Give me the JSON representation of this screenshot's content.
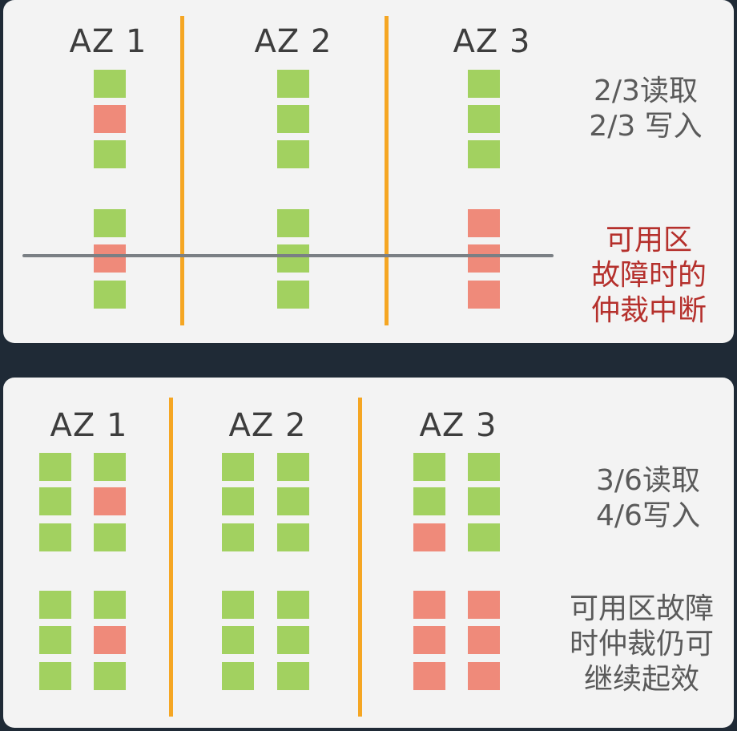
{
  "top_panel": {
    "az_labels": [
      "AZ 1",
      "AZ 2",
      "AZ 3"
    ],
    "rules": [
      "2/3读取",
      "2/3 写入"
    ],
    "failure_note": [
      "可用区",
      "故障时的",
      "仲裁中断"
    ],
    "replicas": {
      "az1": [
        "ok",
        "failed",
        "ok",
        "ok",
        "failed",
        "ok"
      ],
      "az2": [
        "ok",
        "ok",
        "ok",
        "ok",
        "ok",
        "ok"
      ],
      "az3": [
        "ok",
        "ok",
        "ok",
        "failed",
        "failed",
        "failed"
      ]
    }
  },
  "bottom_panel": {
    "az_labels": [
      "AZ 1",
      "AZ 2",
      "AZ 3"
    ],
    "rules": [
      "3/6读取",
      "4/6写入"
    ],
    "failure_note": [
      "可用区故障",
      "时仲裁仍可",
      "继续起效"
    ],
    "replicas": {
      "az1": {
        "left": [
          "ok",
          "ok",
          "ok",
          "ok",
          "ok",
          "ok"
        ],
        "right": [
          "ok",
          "failed",
          "ok",
          "ok",
          "failed",
          "ok"
        ]
      },
      "az2": {
        "left": [
          "ok",
          "ok",
          "ok",
          "ok",
          "ok",
          "ok"
        ],
        "right": [
          "ok",
          "ok",
          "ok",
          "ok",
          "ok",
          "ok"
        ]
      },
      "az3": {
        "left": [
          "ok",
          "ok",
          "failed",
          "failed",
          "failed",
          "failed"
        ],
        "right": [
          "ok",
          "ok",
          "ok",
          "failed",
          "failed",
          "failed"
        ]
      }
    }
  },
  "colors": {
    "healthy": "#a2d160",
    "failed": "#ef8a7a",
    "divider": "#f5a623",
    "failure_text": "#b5302c"
  }
}
